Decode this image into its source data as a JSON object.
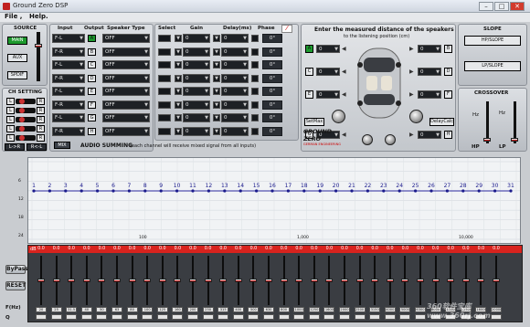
{
  "window": {
    "title": "Ground Zero DSP",
    "minimize": "–",
    "maximize": "□",
    "close": "✕"
  },
  "menu": [
    {
      "label": "File ,"
    },
    {
      "label": "Help."
    }
  ],
  "source": {
    "title": "SOURCE",
    "buttons": [
      {
        "label": "MAIN"
      },
      {
        "label": "AUX"
      },
      {
        "label": "SPDIF"
      }
    ],
    "volume_level": 0.75
  },
  "ch_setting": {
    "title": "CH SETTING",
    "rows": [
      {
        "l": "L",
        "r": "R"
      },
      {
        "l": "L",
        "r": "R"
      },
      {
        "l": "L",
        "r": "R"
      },
      {
        "l": "L",
        "r": "R"
      },
      {
        "l": "L",
        "r": "R"
      }
    ],
    "bottom_left": "L->R",
    "bottom_right": "R<-L"
  },
  "mix_button": "MIX",
  "audio_summing": "AUDIO SUMMING",
  "audio_summing_note": "(each channel will receive mixed signal from all inputs)",
  "routing": {
    "headers": {
      "input": "Input",
      "output": "Output",
      "speaker": "Speaker Type"
    },
    "rows": [
      {
        "input": "F-L",
        "output": "A",
        "speaker": "OFF"
      },
      {
        "input": "F-R",
        "output": "B",
        "speaker": "OFF"
      },
      {
        "input": "F-L",
        "output": "C",
        "speaker": "OFF"
      },
      {
        "input": "F-R",
        "output": "D",
        "speaker": "OFF"
      },
      {
        "input": "F-L",
        "output": "E",
        "speaker": "OFF"
      },
      {
        "input": "F-R",
        "output": "F",
        "speaker": "OFF"
      },
      {
        "input": "F-L",
        "output": "G",
        "speaker": "OFF"
      },
      {
        "input": "F-R",
        "output": "H",
        "speaker": "OFF"
      }
    ]
  },
  "channel_controls": {
    "headers": {
      "select": "Select",
      "gain": "Gain",
      "delay": "Delay(ms)",
      "phase": "Phase"
    },
    "rows": [
      {
        "gain": "0",
        "delay": "0",
        "phase": "0°"
      },
      {
        "gain": "0",
        "delay": "0",
        "phase": "0°"
      },
      {
        "gain": "0",
        "delay": "0",
        "phase": "0°"
      },
      {
        "gain": "0",
        "delay": "0",
        "phase": "0°"
      },
      {
        "gain": "0",
        "delay": "0",
        "phase": "0°"
      },
      {
        "gain": "0",
        "delay": "0",
        "phase": "0°"
      },
      {
        "gain": "0",
        "delay": "0",
        "phase": "0°"
      },
      {
        "gain": "0",
        "delay": "0",
        "phase": "0°"
      }
    ]
  },
  "distance": {
    "title": "Enter the measured distance of the speakers",
    "subtitle": "to the listening position (cm)",
    "left_labels": [
      "A",
      "C",
      "E",
      "G"
    ],
    "right_labels": [
      "B",
      "D",
      "F",
      "H"
    ],
    "values": [
      "0",
      "0",
      "0",
      "0",
      "0",
      "0",
      "0",
      "0"
    ],
    "set_max": "SetMax",
    "delay_calc": "DelayCalc",
    "logo_main": "GROUND ZERO",
    "logo_sub": "GERMAN ENGINEERING"
  },
  "slope": {
    "title": "SLOPE",
    "hp": "HP/SLOPE",
    "lp": "LP/SLOPE"
  },
  "crossover": {
    "title": "CROSSOVER",
    "hz1": "Hz",
    "hz2": "Hz",
    "hp": "HP",
    "lp": "LP"
  },
  "eq_graph": {
    "ylabels": [
      "6",
      "12",
      "18",
      "24"
    ],
    "xlabels": [
      "100",
      "1,000",
      "10,000"
    ],
    "bands": [
      "1",
      "2",
      "3",
      "4",
      "5",
      "6",
      "7",
      "8",
      "9",
      "10",
      "11",
      "12",
      "13",
      "14",
      "15",
      "16",
      "17",
      "18",
      "19",
      "20",
      "21",
      "22",
      "23",
      "24",
      "25",
      "26",
      "27",
      "28",
      "29",
      "30",
      "31"
    ]
  },
  "eq_panel": {
    "db_label": "dB",
    "gain_values": [
      "0.0",
      "0.0",
      "0.0",
      "0.0",
      "0.0",
      "0.0",
      "0.0",
      "0.0",
      "0.0",
      "0.0",
      "0.0",
      "0.0",
      "0.0",
      "0.0",
      "0.0",
      "0.0",
      "0.0",
      "0.0",
      "0.0",
      "0.0",
      "0.0",
      "0.0",
      "0.0",
      "0.0",
      "0.0",
      "0.0",
      "0.0",
      "0.0",
      "0.0",
      "0.0",
      "0.0"
    ],
    "bypass": "ByPass",
    "reset": "RESET",
    "fhz_label": "F(Hz)",
    "q_label": "Q",
    "freqs": [
      "20",
      "25",
      "31.5",
      "40",
      "50",
      "63",
      "80",
      "100",
      "125",
      "160",
      "200",
      "250",
      "315",
      "400",
      "500",
      "630",
      "800",
      "1000",
      "1250",
      "1600",
      "2000",
      "2500",
      "3150",
      "4000",
      "5000",
      "6300",
      "8000",
      "10000",
      "12500",
      "16000",
      "20000"
    ],
    "fader_level": 0.5
  },
  "watermark": "360软件宝库 www.360rj.com"
}
